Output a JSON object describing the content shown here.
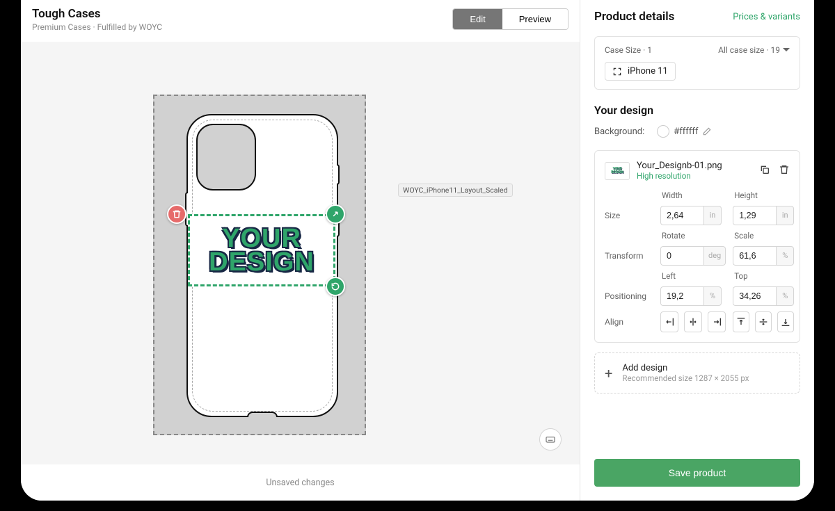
{
  "header": {
    "title": "Tough Cases",
    "subtitle": "Premium Cases · Fulfilled by WOYC",
    "edit_label": "Edit",
    "preview_label": "Preview"
  },
  "canvas": {
    "layer_tooltip": "WOYC_iPhone11_Layout_Scaled",
    "design_line1": "YOUR",
    "design_line2": "DESIGN",
    "status": "Unsaved changes"
  },
  "details": {
    "title": "Product details",
    "prices_link": "Prices & variants",
    "variant_group_label": "Case Size · 1",
    "variant_all_label": "All case size · 19",
    "variant_selected": "iPhone 11",
    "your_design_title": "Your design",
    "background_label": "Background:",
    "background_value": "#ffffff",
    "layer": {
      "filename": "Your_Designb-01.png",
      "resolution": "High resolution",
      "labels": {
        "size": "Size",
        "transform": "Transform",
        "positioning": "Positioning",
        "align": "Align",
        "width": "Width",
        "height": "Height",
        "rotate": "Rotate",
        "scale": "Scale",
        "left": "Left",
        "top": "Top"
      },
      "width": "2,64",
      "width_unit": "in",
      "height": "1,29",
      "height_unit": "in",
      "rotate": "0",
      "rotate_unit": "deg",
      "scale": "61,6",
      "scale_unit": "%",
      "left_val": "19,2",
      "left_unit": "%",
      "top_val": "34,26",
      "top_unit": "%"
    },
    "add_design_title": "Add design",
    "add_design_sub": "Recommended size 1287 × 2055 px",
    "save_label": "Save product"
  }
}
